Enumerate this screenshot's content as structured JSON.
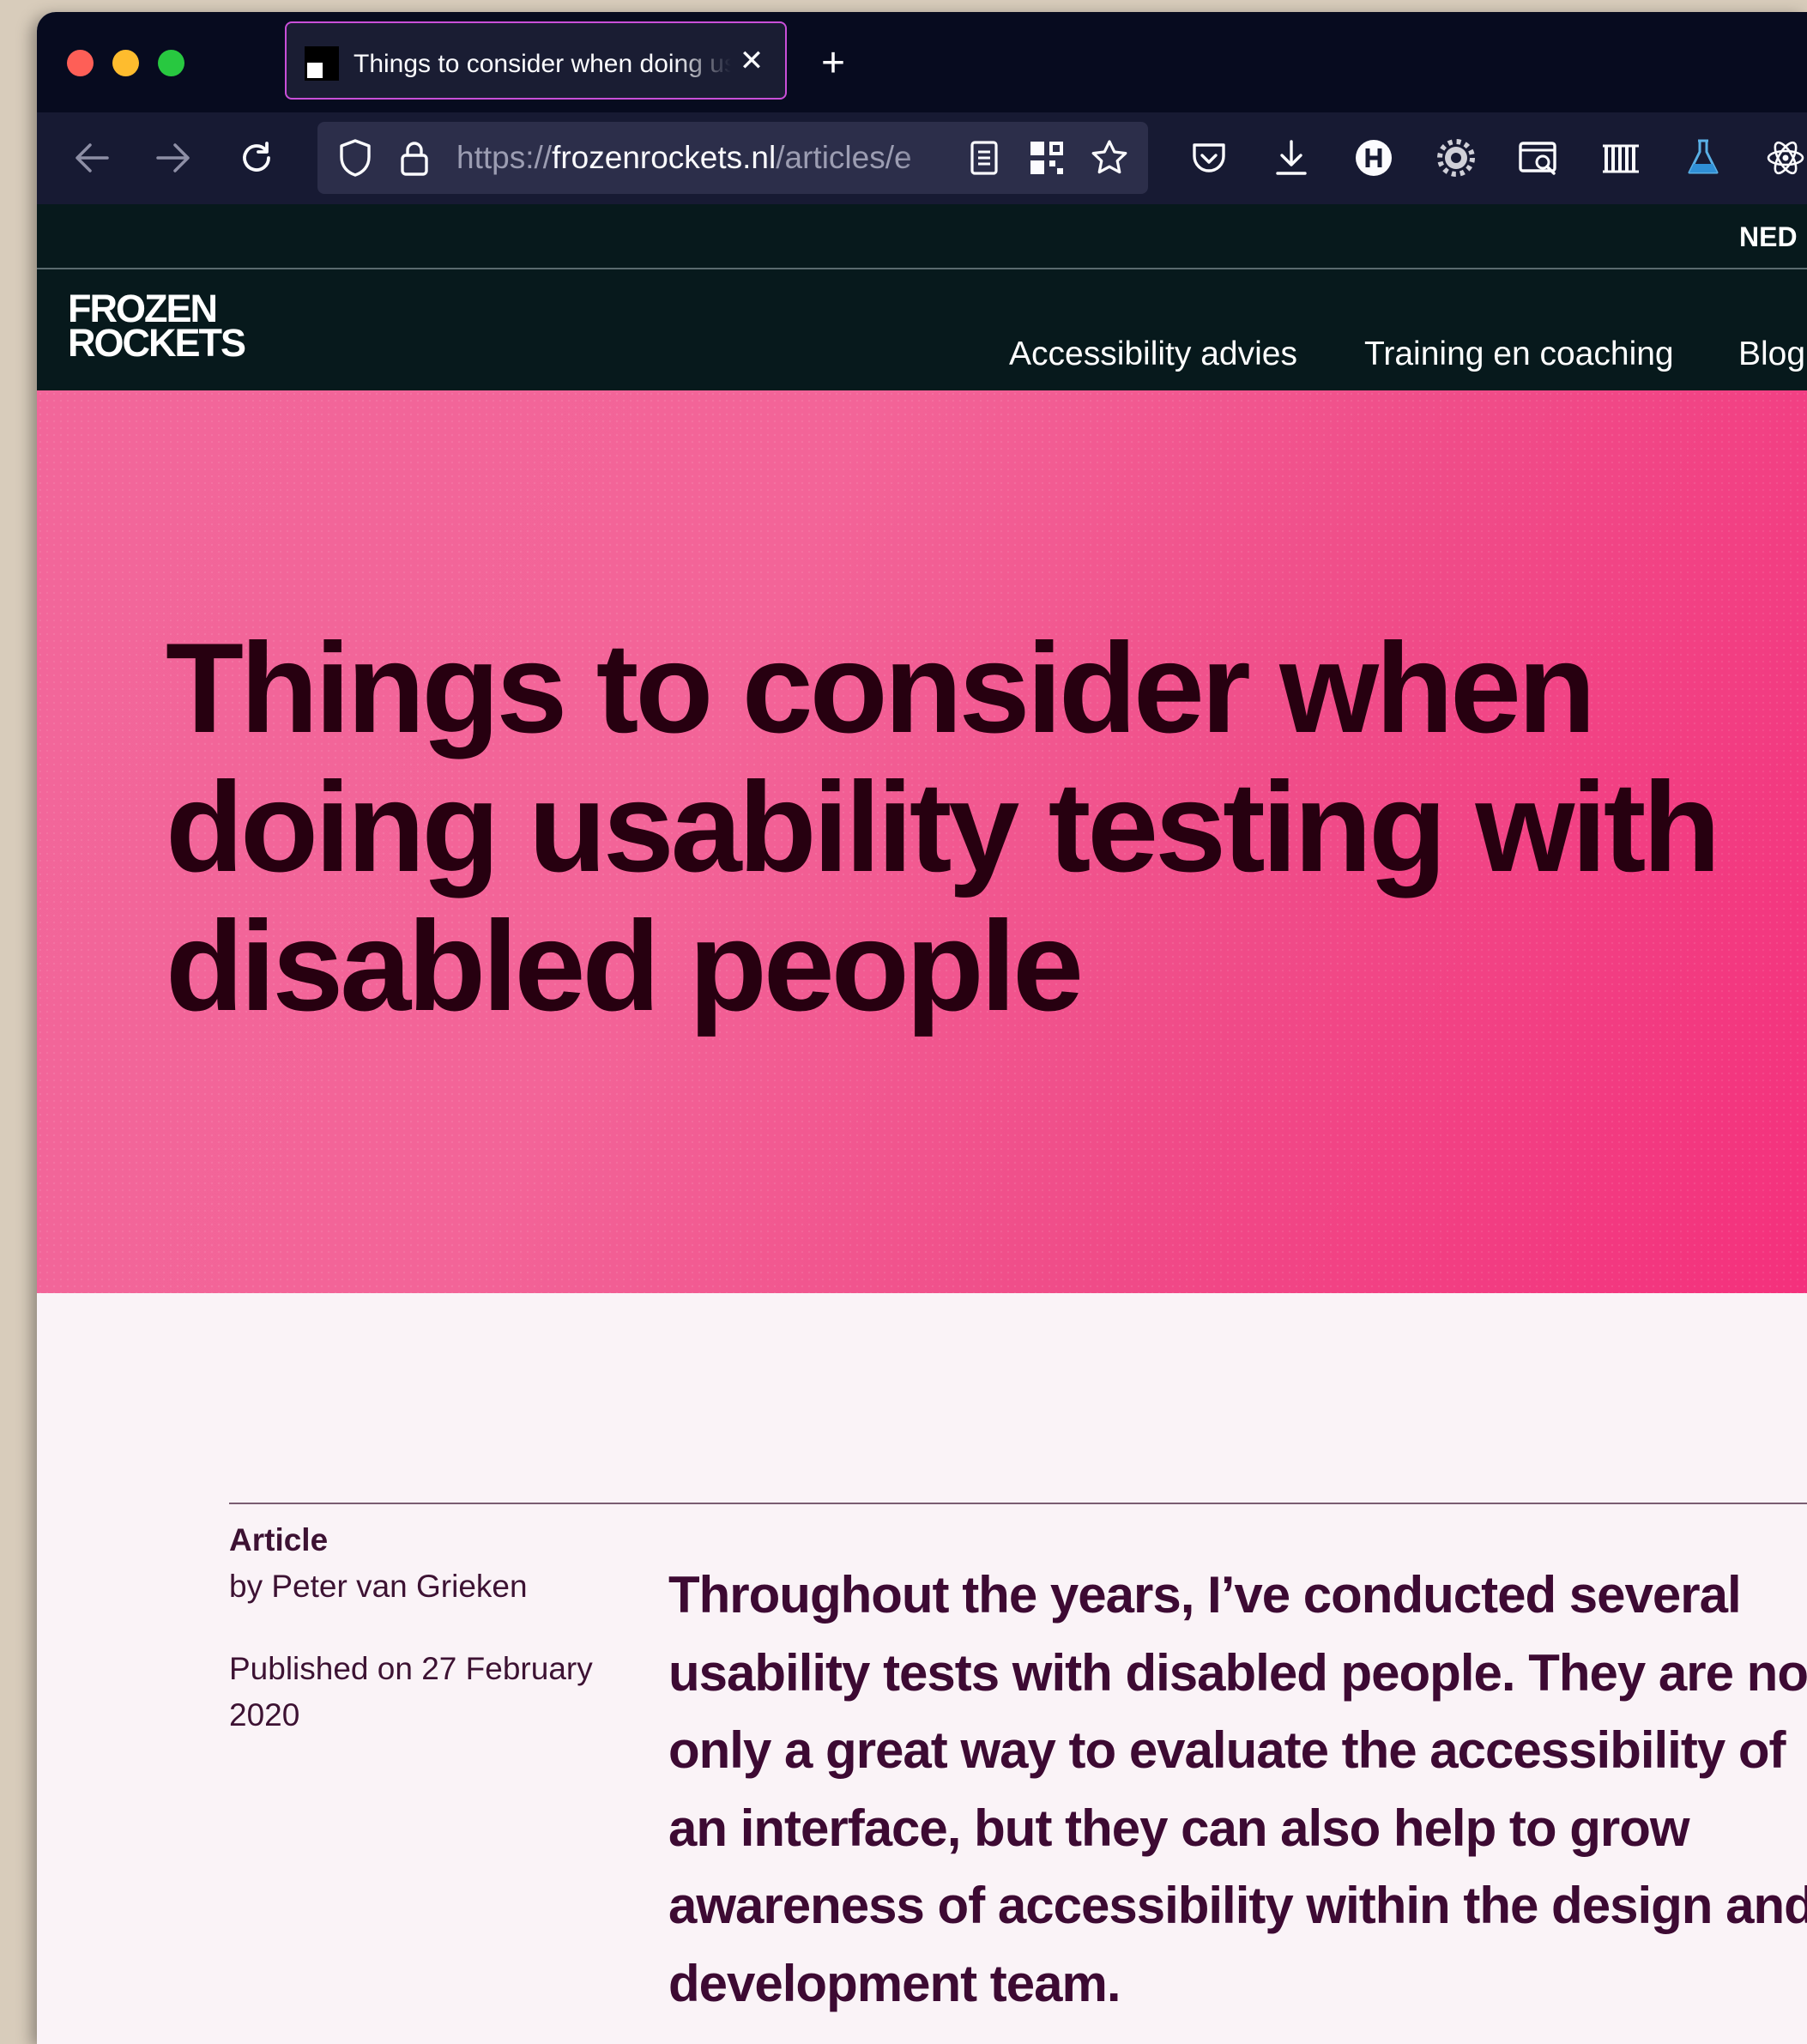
{
  "browser": {
    "tab": {
      "title": "Things to consider when doing usability testing with disabled people"
    },
    "new_tab_symbol": "+",
    "close_symbol": "✕",
    "url": {
      "scheme": "https://",
      "host": "frozenrockets.nl",
      "path": "/articles/e"
    }
  },
  "site": {
    "language_switch": "NED",
    "logo": {
      "line1": "FROZEN",
      "line2": "ROCKETS"
    },
    "nav": [
      "Accessibility advies",
      "Training en coaching",
      "Blog"
    ]
  },
  "hero": {
    "title": "Things to consider when doing usability testing with disabled people"
  },
  "article": {
    "type_label": "Article",
    "author": "by Peter van Grieken",
    "published": "Published on 27 February 2020",
    "lead": "Throughout the years, I’ve conducted several usability tests with disabled people. They are not only a great way to evaluate the accessibility of an interface, but they can also help to grow awareness of accessibility within the design and development team."
  },
  "colors": {
    "titlebar": "#070b1f",
    "toolbar": "#171a33",
    "site_header": "#07191c",
    "hero_pink": "#f36498",
    "hero_text": "#270010",
    "body_text": "#3d0a33",
    "tab_border": "#c94fd8"
  },
  "icons": [
    "back-arrow-icon",
    "forward-arrow-icon",
    "reload-icon",
    "shield-icon",
    "lock-icon",
    "reader-view-icon",
    "qr-code-icon",
    "bookmark-star-icon",
    "pocket-icon",
    "download-icon",
    "extension-h-icon",
    "gear-icon",
    "screenshot-icon",
    "barcode-icon",
    "flask-icon",
    "react-icon"
  ]
}
